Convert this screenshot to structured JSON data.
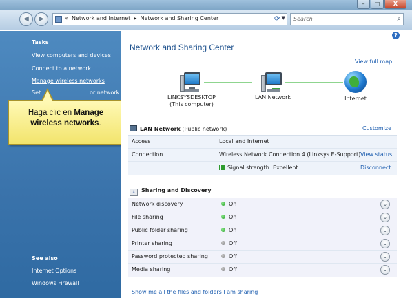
{
  "window": {
    "minimize": "–",
    "maximize": "□",
    "close": "X"
  },
  "nav": {
    "back_icon": "back-arrow",
    "forward_icon": "forward-arrow",
    "address_prefix": "«",
    "breadcrumb": [
      "Network and Internet",
      "Network and Sharing Center"
    ],
    "breadcrumb_sep": "▸",
    "search_placeholder": "Search"
  },
  "sidebar": {
    "tasks_heading": "Tasks",
    "tasks": [
      "View computers and devices",
      "Connect to a network",
      "Manage wireless networks",
      "Set",
      "or network"
    ],
    "see_also_heading": "See also",
    "see_also": [
      "Internet Options",
      "Windows Firewall"
    ]
  },
  "callout": {
    "prefix": "Haga clic en ",
    "bold1": "Manage",
    "bold2": "wireless networks",
    "suffix": "."
  },
  "main": {
    "help": "?",
    "title": "Network and Sharing Center",
    "view_full_map": "View full map",
    "map": {
      "computer_name": "LINKSYSDESKTOP",
      "computer_sub": "(This computer)",
      "lan": "LAN Network",
      "internet": "Internet"
    },
    "network": {
      "name": "LAN Network",
      "type": "(Public network)",
      "customize": "Customize",
      "rows": [
        {
          "label": "Access",
          "value": "Local and Internet"
        },
        {
          "label": "Connection",
          "value": "Wireless Network Connection 4 (Linksys E-Support)",
          "action": "View status"
        },
        {
          "label": "",
          "value": "Signal strength:  Excellent",
          "action": "Disconnect"
        }
      ]
    },
    "sharing": {
      "heading": "Sharing and Discovery",
      "rows": [
        {
          "label": "Network discovery",
          "state": "On"
        },
        {
          "label": "File sharing",
          "state": "On"
        },
        {
          "label": "Public folder sharing",
          "state": "On"
        },
        {
          "label": "Printer sharing",
          "state": "Off"
        },
        {
          "label": "Password protected sharing",
          "state": "Off"
        },
        {
          "label": "Media sharing",
          "state": "Off"
        }
      ],
      "expand_icon": "⌄"
    },
    "bottom_link": "Show me all the files and folders I am sharing"
  }
}
